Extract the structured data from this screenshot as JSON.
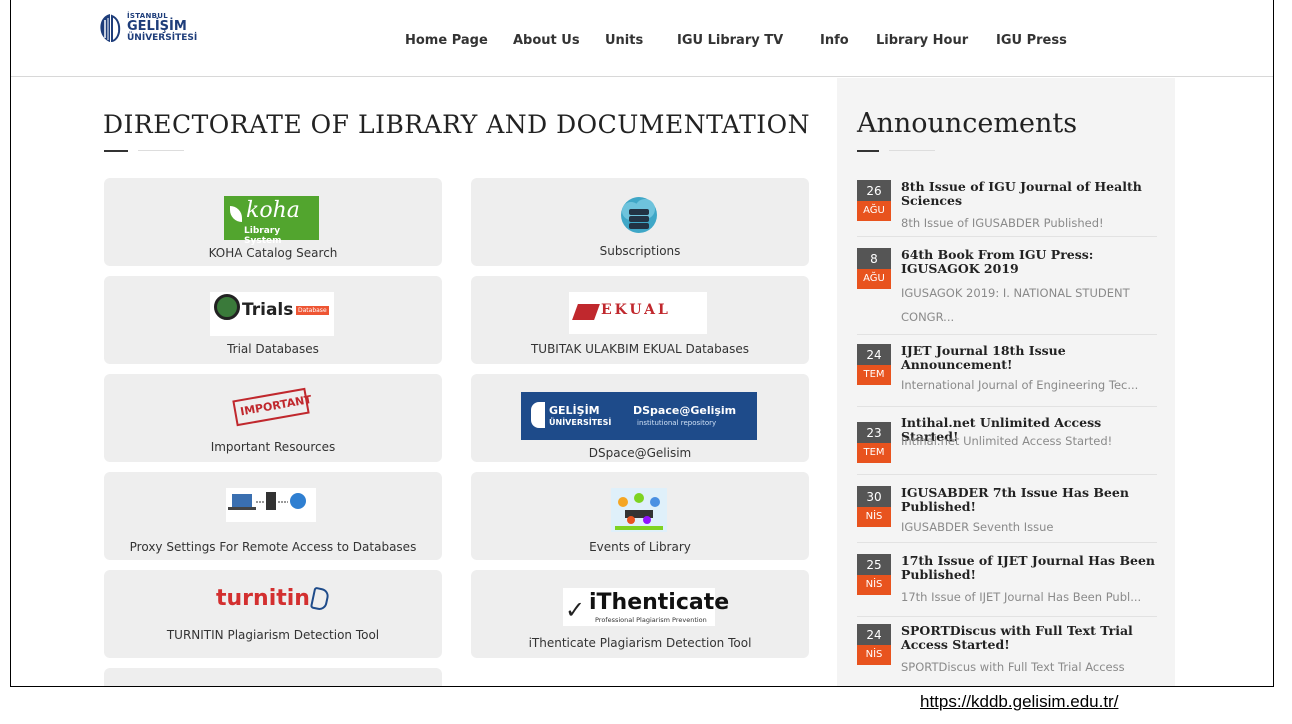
{
  "logo": {
    "line1": "İSTANBUL",
    "line2": "GELİŞİM",
    "line3": "ÜNİVERSİTESİ"
  },
  "nav": [
    "Home Page",
    "About Us",
    "Units",
    "IGU Library TV",
    "Info",
    "Library Hour",
    "IGU Press"
  ],
  "main": {
    "title": "DIRECTORATE OF LIBRARY AND DOCUMENTATION",
    "cards": [
      {
        "label": "KOHA Catalog Search",
        "logo": "koha",
        "logo_text": "koha",
        "logo_sub": "Library System"
      },
      {
        "label": "Subscriptions",
        "logo": "database-cloud"
      },
      {
        "label": "Trial Databases",
        "logo": "trials",
        "logo_text": "Trials",
        "logo_sub": "Database"
      },
      {
        "label": "TUBITAK ULAKBIM EKUAL Databases",
        "logo": "ekual",
        "logo_text": "EKUAL"
      },
      {
        "label": "Important Resources",
        "logo": "important-stamp",
        "logo_text": "IMPORTANT"
      },
      {
        "label": "DSpace@Gelisim",
        "logo": "dspace",
        "logo_text": "DSpace@Gelişim",
        "logo_sub": "institutional repository",
        "logo_brand": "GELİŞİM",
        "logo_brand2": "ÜNİVERSİTESİ"
      },
      {
        "label": "Proxy Settings For Remote Access to Databases",
        "logo": "proxy-diagram"
      },
      {
        "label": "Events of Library",
        "logo": "events-illustration"
      },
      {
        "label": "TURNITIN Plagiarism Detection Tool",
        "logo": "turnitin",
        "logo_text": "turnitin"
      },
      {
        "label": "iThenticate Plagiarism Detection Tool",
        "logo": "ithenticate",
        "logo_text": "iThenticate",
        "logo_sub": "Professional Plagiarism Prevention"
      }
    ]
  },
  "sidebar": {
    "title": "Announcements",
    "items": [
      {
        "day": "26",
        "month": "AĞU",
        "title": "8th Issue of IGU Journal of Health Sciences",
        "desc": "8th Issue of IGUSABDER Published!"
      },
      {
        "day": "8",
        "month": "AĞU",
        "title": "64th Book From IGU Press: IGUSAGOK 2019",
        "desc": "IGUSAGOK 2019: I. NATIONAL STUDENT",
        "desc2": "CONGR..."
      },
      {
        "day": "24",
        "month": "TEM",
        "title": "IJET Journal 18th Issue Announcement!",
        "desc": "International Journal of Engineering Tec..."
      },
      {
        "day": "23",
        "month": "TEM",
        "title": "Intihal.net Unlimited Access Started!",
        "desc": "Intihal.net Unlimited Access Started!"
      },
      {
        "day": "30",
        "month": "NİS",
        "title": "IGUSABDER 7th Issue Has Been Published!",
        "desc": "IGUSABDER Seventh Issue"
      },
      {
        "day": "25",
        "month": "NİS",
        "title": "17th Issue of IJET Journal Has Been Published!",
        "desc": "17th Issue of IJET Journal Has Been Publ..."
      },
      {
        "day": "24",
        "month": "NİS",
        "title": "SPORTDiscus with Full Text Trial Access Started!",
        "desc": "SPORTDiscus with Full Text Trial Access"
      }
    ]
  },
  "url": "https://kddb.gelisim.edu.tr/",
  "colors": {
    "accent": "#e8531e",
    "date_bg": "#555555",
    "brand_blue": "#1e3d7a",
    "card_bg": "#eeeeee"
  }
}
